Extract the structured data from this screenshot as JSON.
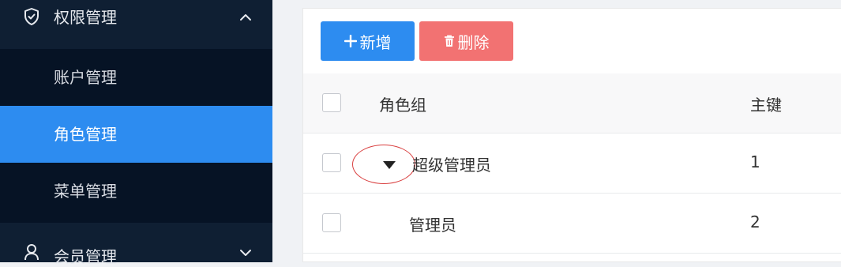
{
  "sidebar": {
    "group_permission": {
      "label": "权限管理",
      "icon": "shield-check-icon",
      "expanded": true
    },
    "submenu": [
      {
        "label": "账户管理",
        "active": false
      },
      {
        "label": "角色管理",
        "active": true
      },
      {
        "label": "菜单管理",
        "active": false
      }
    ],
    "group_member": {
      "label": "会员管理",
      "icon": "user-icon",
      "expanded": false
    },
    "colors": {
      "bg": "#0f1f33",
      "submenu_bg": "#061325",
      "active": "#2d8cf0"
    }
  },
  "toolbar": {
    "add_label": "新增",
    "add_icon": "plus-icon",
    "delete_label": "删除",
    "delete_icon": "trash-icon",
    "colors": {
      "add": "#2d8cf0",
      "delete": "#f27272"
    }
  },
  "table": {
    "columns": [
      "角色组",
      "主键"
    ],
    "rows": [
      {
        "name": "超级管理员",
        "key": "1",
        "expandable": true,
        "expanded": true
      },
      {
        "name": "管理员",
        "key": "2",
        "expandable": false,
        "expanded": false
      }
    ]
  },
  "annotation": {
    "shape": "ellipse",
    "color": "#d94040"
  }
}
